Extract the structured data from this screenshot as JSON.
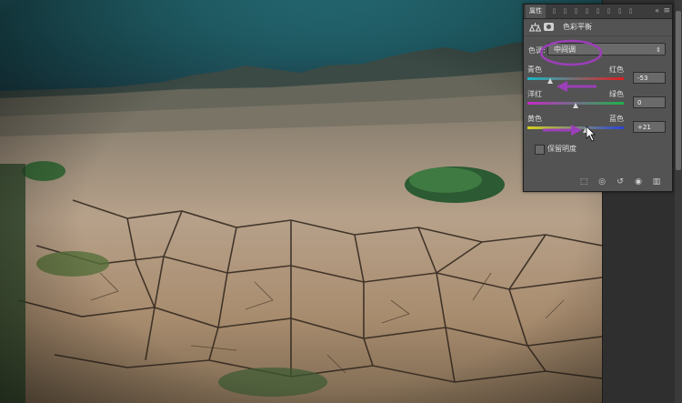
{
  "panel": {
    "tabs": [
      {
        "label": "属性",
        "active": true
      },
      {
        "icon": "tab-glyph-1"
      },
      {
        "icon": "tab-glyph-2"
      },
      {
        "icon": "tab-glyph-3"
      },
      {
        "icon": "tab-glyph-4"
      },
      {
        "icon": "tab-glyph-5"
      },
      {
        "icon": "tab-glyph-6"
      },
      {
        "icon": "tab-glyph-7"
      },
      {
        "icon": "tab-glyph-8"
      }
    ],
    "collapse_glyph": "«",
    "menu_glyph": "≡",
    "adjustment_title": "色彩平衡",
    "tone": {
      "label": "色调:",
      "value": "中间调",
      "arrow": "⇕"
    },
    "sliders": [
      {
        "left": "青色",
        "right": "红色",
        "value": "-53",
        "level": -53,
        "min": -100,
        "max": 100,
        "gradient": [
          "#19b7c4",
          "#dc1f1f"
        ]
      },
      {
        "left": "洋红",
        "right": "绿色",
        "value": "0",
        "level": 0,
        "min": -100,
        "max": 100,
        "gradient": [
          "#c62bc6",
          "#1fb24a"
        ]
      },
      {
        "left": "黄色",
        "right": "蓝色",
        "value": "+21",
        "level": 21,
        "min": -100,
        "max": 100,
        "gradient": [
          "#d6d01f",
          "#2a45d4"
        ]
      }
    ],
    "preserve_luminosity": {
      "label": "保留明度",
      "checked": false
    },
    "footer_icons": [
      "clip-to-layer-icon",
      "view-previous-icon",
      "reset-icon",
      "visibility-icon",
      "delete-icon"
    ]
  },
  "colors": {
    "annotation": "#9b3fb8",
    "panel_bg": "#535353"
  }
}
